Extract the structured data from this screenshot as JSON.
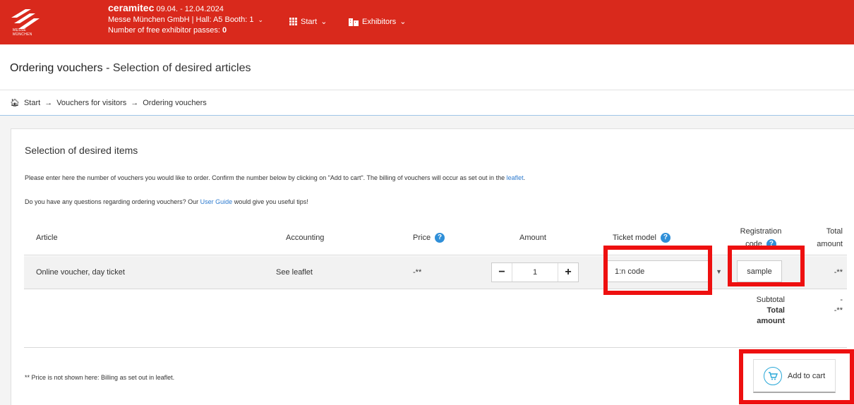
{
  "header": {
    "logo_text": [
      "MESSE",
      "MÜNCHEN"
    ],
    "brand": "ceramitec",
    "dates": "09.04. - 12.04.2024",
    "company": "Messe München GmbH | Hall: A5 Booth: 1",
    "free_passes_label": "Number of free exhibitor passes:",
    "free_passes_value": "0",
    "nav_start": "Start",
    "nav_exhibitors": "Exhibitors"
  },
  "page": {
    "title_bold": "Ordering vouchers",
    "title_rest": " - Selection of desired articles"
  },
  "breadcrumb": [
    "Start",
    "Vouchers for visitors",
    "Ordering vouchers"
  ],
  "section": {
    "title": "Selection of desired items",
    "intro_before": "Please enter here the number of vouchers you would like to order. Confirm the number below by clicking on \"Add to cart\". The billing of vouchers will occur as set out in the ",
    "intro_link": "leaflet",
    "intro_after": ".",
    "guide_before": "Do you have any questions regarding ordering vouchers? Our ",
    "guide_link": "User Guide",
    "guide_after": " would give you useful tips!"
  },
  "table": {
    "headers": {
      "article": "Article",
      "accounting": "Accounting",
      "price": "Price",
      "amount": "Amount",
      "ticket_model": "Ticket model",
      "registration_code_1": "Registration",
      "registration_code_2": "code",
      "total_1": "Total",
      "total_2": "amount"
    },
    "row": {
      "article": "Online voucher, day ticket",
      "accounting": "See leaflet",
      "price": "-**",
      "amount": "1",
      "ticket_model": "1:n code",
      "registration_code": "sample",
      "total": "-**"
    },
    "subtotal_label": "Subtotal",
    "subtotal_value": "-",
    "total_label_1": "Total",
    "total_label_2": "amount",
    "total_value": "-**"
  },
  "footnote": "** Price is not shown here: Billing as set out in leaflet.",
  "add_to_cart": "Add to cart",
  "colors": {
    "header_bg": "#d9291c",
    "highlight": "#ee1010",
    "link": "#2e7bcf",
    "help_icon": "#2f8fd8"
  }
}
